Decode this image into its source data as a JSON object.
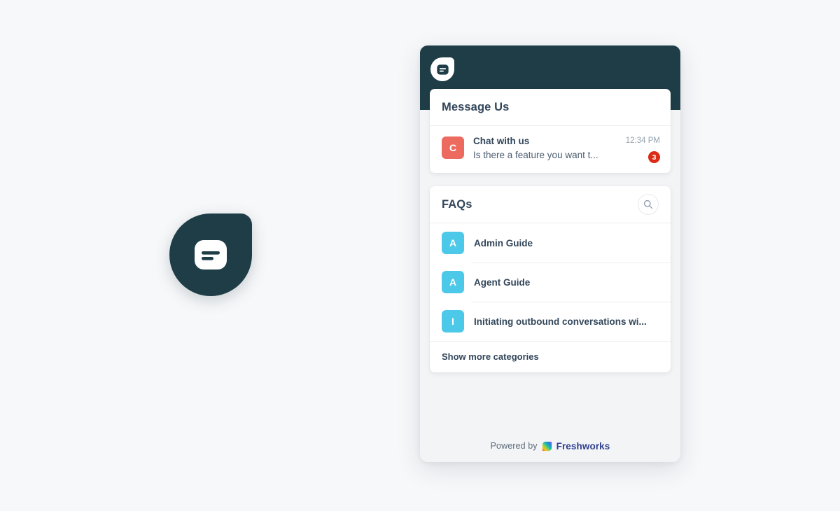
{
  "theme": {
    "page_background": "#f7f8fa",
    "header_dark": "#1e3d46",
    "widget_background": "#f3f4f6",
    "card_background": "#ffffff",
    "conversation_avatar": "#ec6a5e",
    "unread_badge": "#db2b17",
    "faq_avatar": "#4cc8e8",
    "title_text": "#32465a",
    "brand_text": "#2f3f8f"
  },
  "launcher": {
    "icon": "chat-bubble-icon",
    "aria_label": "Open chat widget"
  },
  "widget": {
    "header": {
      "logo_icon": "chat-bubble-icon"
    },
    "messages_card": {
      "title": "Message Us",
      "conversations": [
        {
          "avatar_initial": "C",
          "name": "Chat with us",
          "preview": "Is there a feature you want t...",
          "time": "12:34 PM",
          "unread_count": "3"
        }
      ]
    },
    "faq_card": {
      "title": "FAQs",
      "search_icon": "search-icon",
      "items": [
        {
          "avatar_initial": "A",
          "label": "Admin Guide"
        },
        {
          "avatar_initial": "A",
          "label": "Agent Guide"
        },
        {
          "avatar_initial": "I",
          "label": "Initiating outbound conversations wi..."
        }
      ],
      "show_more_label": "Show more categories"
    },
    "footer": {
      "powered_by_label": "Powered by",
      "brand_name": "Freshworks",
      "brand_logo_icon": "freshworks-logo-icon"
    }
  }
}
